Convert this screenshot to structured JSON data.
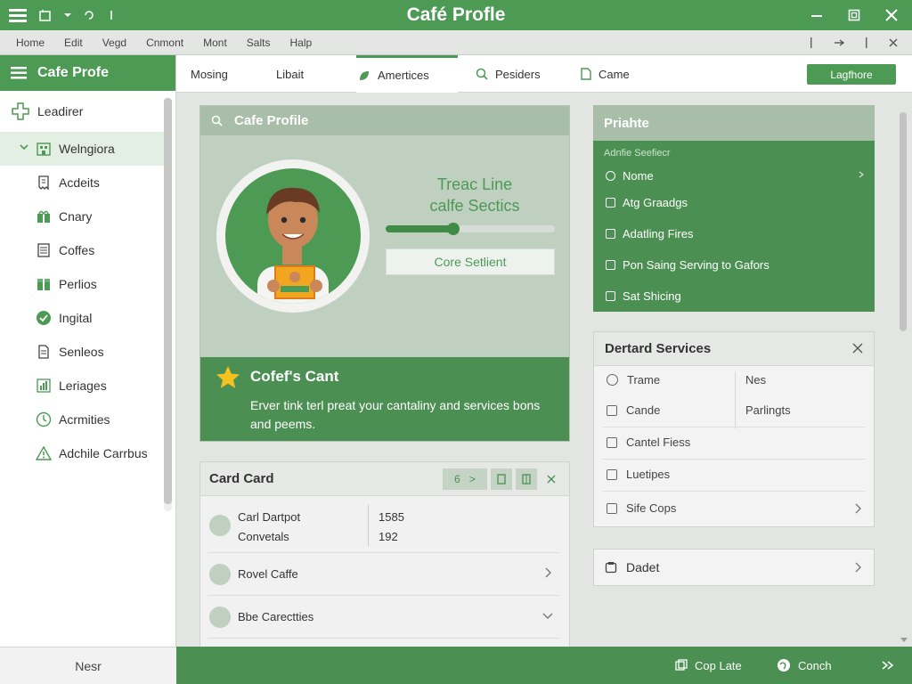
{
  "window": {
    "title": "Café Profle"
  },
  "menu": {
    "items": [
      "Home",
      "Edit",
      "Vegd",
      "Cnmont",
      "Mont",
      "Salts",
      "Halp"
    ]
  },
  "sidebar": {
    "title": "Cafe Profe",
    "items": [
      {
        "label": "Leadirer",
        "icon": "plus-cross-icon"
      },
      {
        "label": "Welngiora",
        "icon": "building-icon"
      },
      {
        "label": "Acdeits",
        "icon": "receipt-icon"
      },
      {
        "label": "Cnary",
        "icon": "gift-icon"
      },
      {
        "label": "Coffes",
        "icon": "list-icon"
      },
      {
        "label": "Perlios",
        "icon": "box-icon"
      },
      {
        "label": "Ingital",
        "icon": "check-circle-icon"
      },
      {
        "label": "Senleos",
        "icon": "document-icon"
      },
      {
        "label": "Leriages",
        "icon": "chart-icon"
      },
      {
        "label": "Acrmities",
        "icon": "clock-icon"
      },
      {
        "label": "Adchile Carrbus",
        "icon": "warning-icon"
      }
    ],
    "footer": "Nesr"
  },
  "tabs": [
    {
      "label": "Mosing"
    },
    {
      "label": "Libait"
    },
    {
      "label": "Amertices"
    },
    {
      "label": "Pesiders"
    },
    {
      "label": "Came"
    }
  ],
  "tab_button": "Lagfhore",
  "profile": {
    "header": "Cafe Profile",
    "title_line1": "Treac Line",
    "title_line2": "calfe Sectics",
    "progress": 0.4,
    "button": "Core Setlient",
    "footer_title": "Cofef's Cant",
    "footer_desc": "Erver tink terl preat your cantaliny and services bons and peems."
  },
  "card_card": {
    "title": "Card Card",
    "tools": [
      "6",
      ">",
      "[]",
      "m",
      "X"
    ],
    "rows": [
      {
        "label": "Carl Dartpot",
        "sub": "Convetals",
        "v1": "1585",
        "v2": "192"
      },
      {
        "label": "Rovel Caffe"
      },
      {
        "label": "Bbe Carectties"
      }
    ]
  },
  "privacy": {
    "title": "Priahte",
    "sublabel": "Adnfie Seefiecr",
    "items": [
      "Nome",
      "Atg Graadgs",
      "Adatling Fires",
      "Pon Saing Serving to Gafors",
      "Sat Shicing"
    ]
  },
  "services": {
    "title": "Dertard Services",
    "items": [
      {
        "label": "Trame",
        "right": "Nes"
      },
      {
        "label": "Cande",
        "right": "Parlingts"
      },
      {
        "label": "Cantel Fiess"
      },
      {
        "label": "Luetipes"
      },
      {
        "label": "Sife Cops"
      }
    ]
  },
  "dadet": {
    "label": "Dadet"
  },
  "status": {
    "copy": "Cop Late",
    "conch": "Conch"
  },
  "colors": {
    "accent": "#4c9a54",
    "accent_dark": "#4c8f52",
    "panel_muted": "#bfcfc0"
  }
}
